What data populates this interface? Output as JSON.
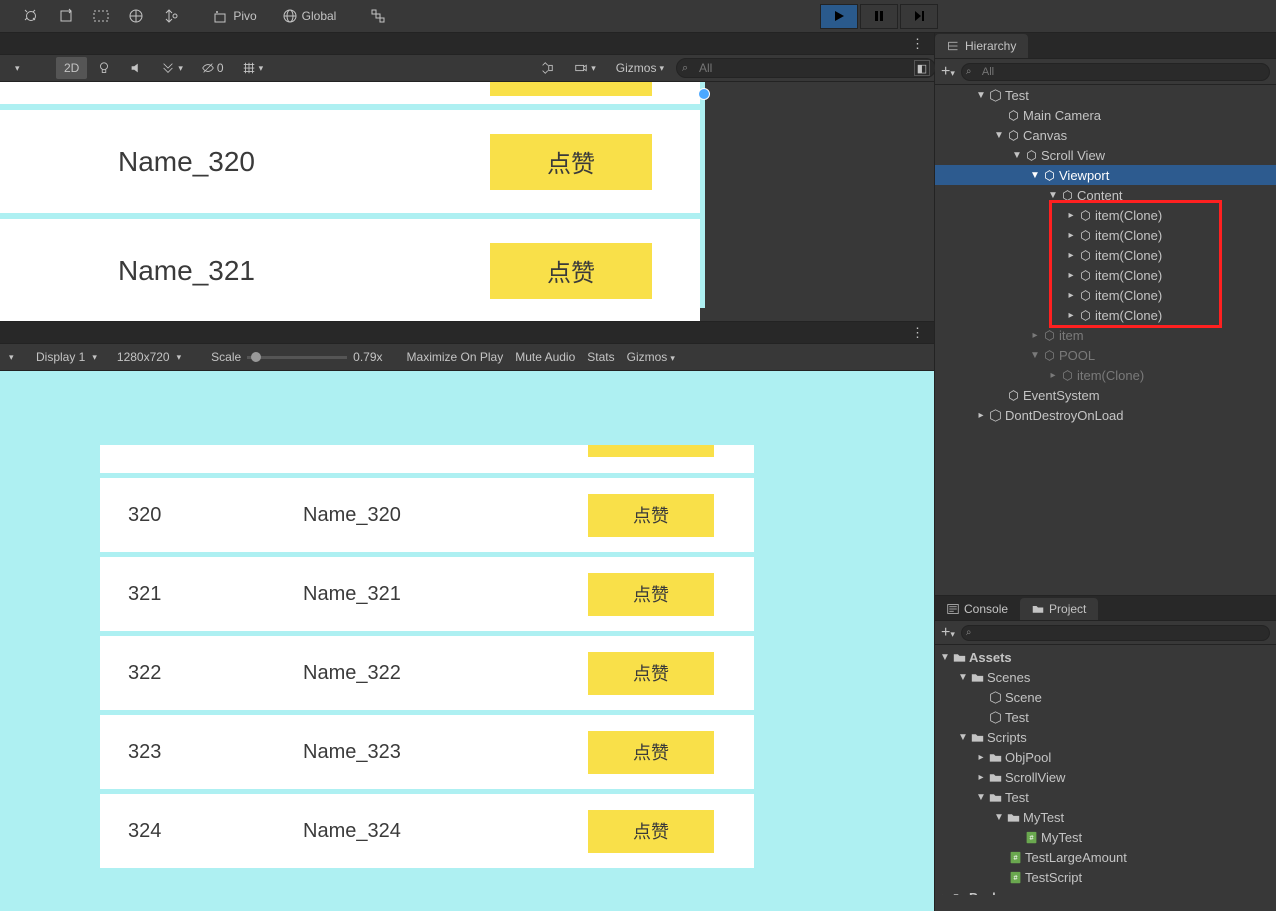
{
  "top_toolbar": {
    "pivot_label": "Pivo",
    "global_label": "Global"
  },
  "scene_toolbar": {
    "mode_2d": "2D",
    "counter": "0",
    "gizmos_label": "Gizmos",
    "search_placeholder": "All"
  },
  "scene": {
    "rows": [
      {
        "name": "Name_320",
        "btn": "点赞"
      },
      {
        "name": "Name_321",
        "btn": "点赞"
      }
    ]
  },
  "game_toolbar": {
    "display": "Display 1",
    "resolution": "1280x720",
    "scale_label": "Scale",
    "scale_value": "0.79x",
    "maximize": "Maximize On Play",
    "mute": "Mute Audio",
    "stats": "Stats",
    "gizmos": "Gizmos"
  },
  "game": {
    "rows": [
      {
        "num": "320",
        "name": "Name_320",
        "btn": "点赞"
      },
      {
        "num": "321",
        "name": "Name_321",
        "btn": "点赞"
      },
      {
        "num": "322",
        "name": "Name_322",
        "btn": "点赞"
      },
      {
        "num": "323",
        "name": "Name_323",
        "btn": "点赞"
      },
      {
        "num": "324",
        "name": "Name_324",
        "btn": "点赞"
      }
    ]
  },
  "hierarchy": {
    "tab": "Hierarchy",
    "search_placeholder": "All",
    "nodes": {
      "test": "Test",
      "main_camera": "Main Camera",
      "canvas": "Canvas",
      "scroll_view": "Scroll View",
      "viewport": "Viewport",
      "content": "Content",
      "clone0": "item(Clone)",
      "clone1": "item(Clone)",
      "clone2": "item(Clone)",
      "clone3": "item(Clone)",
      "clone4": "item(Clone)",
      "clone5": "item(Clone)",
      "item": "item",
      "pool": "POOL",
      "pool_clone": "item(Clone)",
      "event_system": "EventSystem",
      "dont_destroy": "DontDestroyOnLoad"
    }
  },
  "bottom": {
    "console_tab": "Console",
    "project_tab": "Project",
    "assets": "Assets",
    "scenes": "Scenes",
    "scene": "Scene",
    "test": "Test",
    "scripts": "Scripts",
    "objpool": "ObjPool",
    "scrollview": "ScrollView",
    "test_folder": "Test",
    "mytest_folder": "MyTest",
    "mytest": "MyTest",
    "test_large": "TestLargeAmount",
    "test_script": "TestScript",
    "packages": "Packages"
  }
}
